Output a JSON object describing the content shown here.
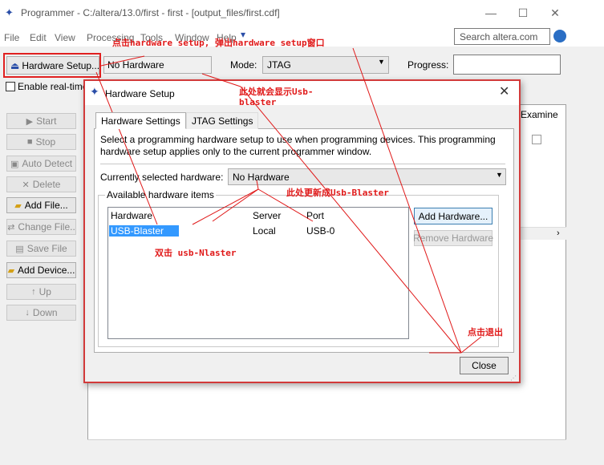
{
  "window": {
    "title": "Programmer - C:/altera/13.0/first - first - [output_files/first.cdf]",
    "minimize": "—",
    "maximize": "☐",
    "close": "✕"
  },
  "menu": [
    "File",
    "Edit",
    "View",
    "Processing",
    "Tools",
    "Window",
    "Help"
  ],
  "search": {
    "placeholder": "Search altera.com"
  },
  "toolbar": {
    "hardware_setup_label": "Hardware Setup...",
    "hardware_value": "No Hardware",
    "mode_label": "Mode:",
    "mode_value": "JTAG",
    "progress_label": "Progress:",
    "realtime_label": "Enable real-time"
  },
  "side_buttons": [
    {
      "label": "Start",
      "icon": "play-icon",
      "enabled": false
    },
    {
      "label": "Stop",
      "icon": "stop-icon",
      "enabled": false
    },
    {
      "label": "Auto Detect",
      "icon": "detect-icon",
      "enabled": false
    },
    {
      "label": "Delete",
      "icon": "delete-icon",
      "enabled": false
    },
    {
      "label": "Add File...",
      "icon": "folder-icon",
      "enabled": true
    },
    {
      "label": "Change File..",
      "icon": "change-icon",
      "enabled": false
    },
    {
      "label": "Save File",
      "icon": "save-icon",
      "enabled": false
    },
    {
      "label": "Add Device...",
      "icon": "device-icon",
      "enabled": true
    },
    {
      "label": "Up",
      "icon": "up-icon",
      "enabled": false
    },
    {
      "label": "Down",
      "icon": "down-icon",
      "enabled": false
    }
  ],
  "main": {
    "examine_header": "Examine"
  },
  "dialog": {
    "title": "Hardware Setup",
    "close": "✕",
    "tabs": [
      "Hardware Settings",
      "JTAG Settings"
    ],
    "description": "Select a programming hardware setup to use when programming devices. This programming hardware setup applies only to the current programmer window.",
    "current_label": "Currently selected hardware:",
    "current_value": "No Hardware",
    "available_label": "Available hardware items",
    "columns": [
      "Hardware",
      "Server",
      "Port"
    ],
    "rows": [
      {
        "hardware": "USB-Blaster",
        "server": "Local",
        "port": "USB-0"
      }
    ],
    "add_hardware": "Add Hardware...",
    "remove_hardware": "Remove Hardware",
    "close_button": "Close"
  },
  "annotations": {
    "click_setup": "点击hardware setup, 弹出hardware setup窗口",
    "shows_usb_1": "此处就会显示Usb-",
    "shows_usb_2": "blaster",
    "update_usb": "此处更新成Usb-Blaster",
    "double_click": "双击 usb-Nlaster",
    "click_exit": "点击退出"
  },
  "colors": {
    "annotation": "#e01818",
    "selection": "#3399ff",
    "dialog_border": "#d23a3a"
  }
}
